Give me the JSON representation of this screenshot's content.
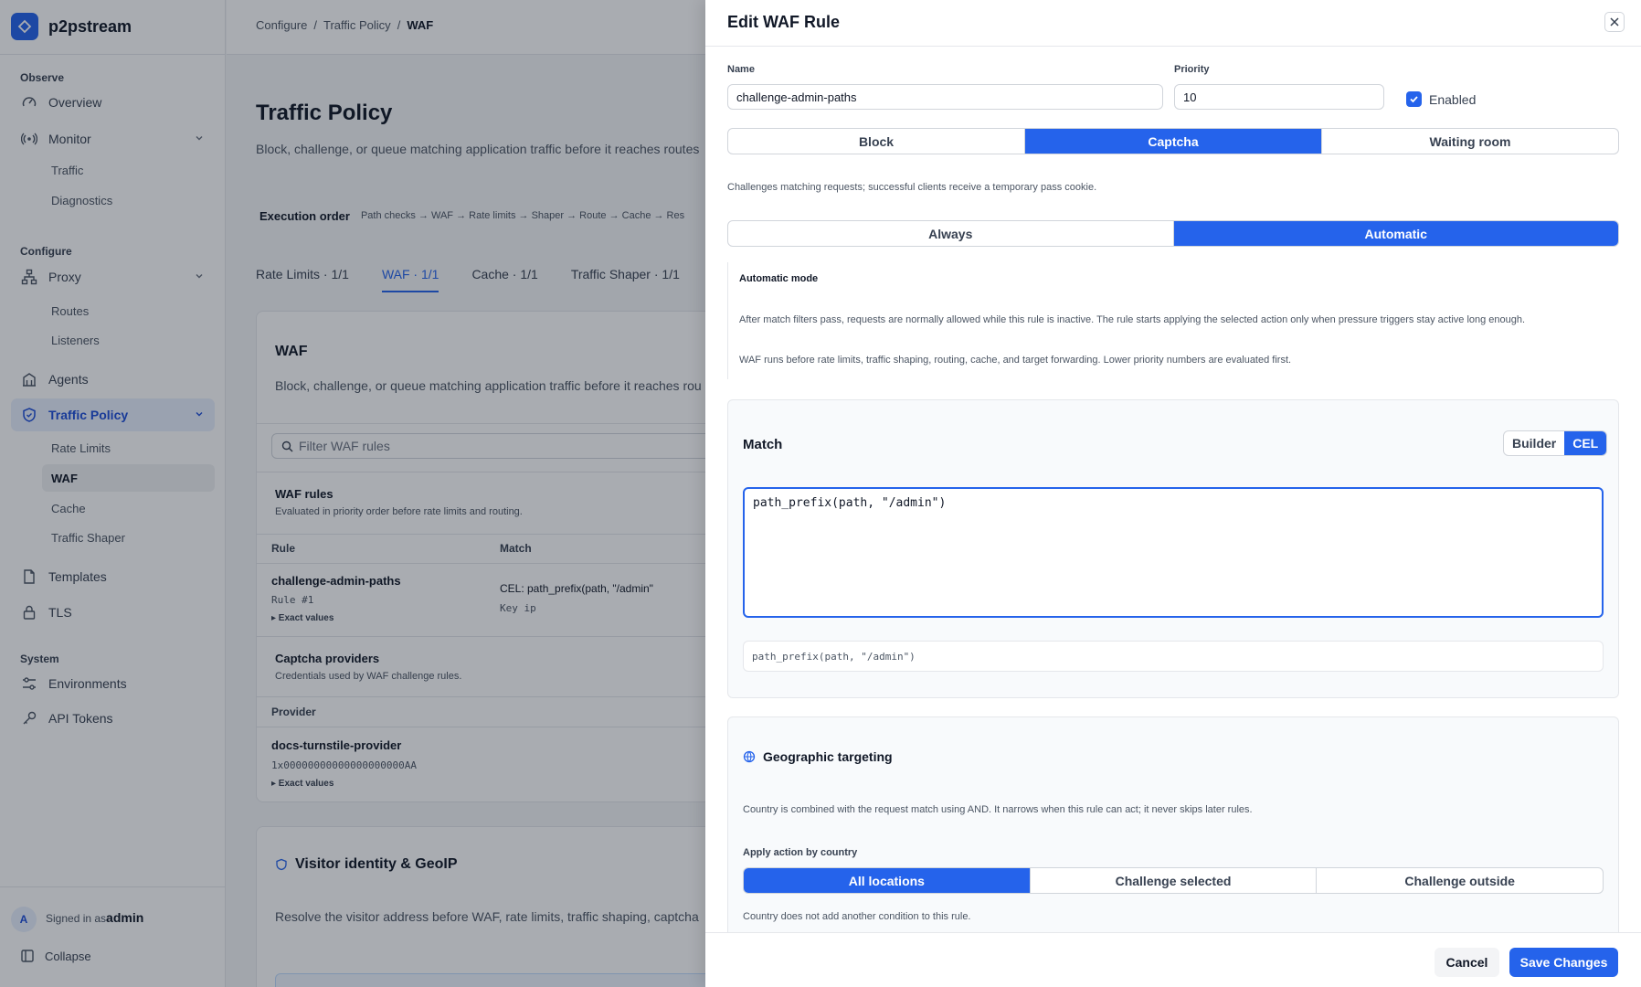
{
  "app": {
    "name": "p2pstream"
  },
  "sidebar": {
    "sections": {
      "observe": "Observe",
      "configure": "Configure",
      "system": "System"
    },
    "items": {
      "overview": "Overview",
      "monitor": "Monitor",
      "traffic": "Traffic",
      "diagnostics": "Diagnostics",
      "proxy": "Proxy",
      "routes": "Routes",
      "listeners": "Listeners",
      "agents": "Agents",
      "traffic_policy": "Traffic Policy",
      "rate_limits": "Rate Limits",
      "waf": "WAF",
      "cache": "Cache",
      "traffic_shaper": "Traffic Shaper",
      "templates": "Templates",
      "tls": "TLS",
      "environments": "Environments",
      "api_tokens": "API Tokens"
    },
    "user": {
      "initial": "A",
      "signed_in_as": "Signed in as",
      "name": "admin"
    },
    "collapse": "Collapse"
  },
  "breadcrumb": [
    "Configure",
    "/",
    "Traffic Policy",
    "/",
    "WAF"
  ],
  "page": {
    "title": "Traffic Policy",
    "subtitle": "Block, challenge, or queue matching application traffic before it reaches routes",
    "execution_label": "Execution order",
    "execution_value": "Path checks → WAF → Rate limits → Shaper → Route → Cache → Res",
    "tabs": [
      "Rate Limits · 1/1",
      "WAF · 1/1",
      "Cache · 1/1",
      "Traffic Shaper · 1/1"
    ]
  },
  "waf_card": {
    "title": "WAF",
    "description": "Block, challenge, or queue matching application traffic before it reaches rou",
    "filter_placeholder": "Filter WAF rules",
    "rules_title": "WAF rules",
    "rules_subtitle": "Evaluated in priority order before rate limits and routing.",
    "col_rule": "Rule",
    "col_match": "Match",
    "rule": {
      "name": "challenge-admin-paths",
      "number": "Rule #1",
      "exact": "▸ Exact values",
      "match": "CEL: path_prefix(path, \"/admin\"",
      "key": "Key ip"
    },
    "captcha_title": "Captcha providers",
    "captcha_subtitle": "Credentials used by WAF challenge rules.",
    "col_provider": "Provider",
    "provider": {
      "name": "docs-turnstile-provider",
      "key": "1x00000000000000000000AA",
      "exact": "▸ Exact values"
    }
  },
  "identity_card": {
    "title": "Visitor identity & GeoIP",
    "description": "Resolve the visitor address before WAF, rate limits, traffic shaping, captcha"
  },
  "drawer": {
    "title": "Edit WAF Rule",
    "name_label": "Name",
    "name_value": "challenge-admin-paths",
    "priority_label": "Priority",
    "priority_value": "10",
    "enabled_label": "Enabled",
    "actions": [
      "Block",
      "Captcha",
      "Waiting room"
    ],
    "action_selected": "Captcha",
    "action_help": "Challenges matching requests; successful clients receive a temporary pass cookie.",
    "modes": [
      "Always",
      "Automatic"
    ],
    "mode_selected": "Automatic",
    "mode_title": "Automatic mode",
    "mode_text_1": "After match filters pass, requests are normally allowed while this rule is inactive. The rule starts applying the selected action only when pressure triggers stay active long enough.",
    "mode_text_2": "WAF runs before rate limits, traffic shaping, routing, cache, and target forwarding. Lower priority numbers are evaluated first.",
    "match": {
      "title": "Match",
      "toggle": [
        "Builder",
        "CEL"
      ],
      "toggle_selected": "CEL",
      "expression": "path_prefix(path, \"/admin\")",
      "preview": "path_prefix(path, \"/admin\")"
    },
    "geo": {
      "title": "Geographic targeting",
      "description": "Country is combined with the request match using AND. It narrows when this rule can act; it never skips later rules.",
      "apply_label": "Apply action by country",
      "options": [
        "All locations",
        "Challenge selected",
        "Challenge outside"
      ],
      "selected": "All locations",
      "note": "Country does not add another condition to this rule."
    },
    "cancel": "Cancel",
    "save": "Save Changes"
  },
  "colors": {
    "accent": "#2563eb",
    "accent_soft": "#e8effd"
  }
}
